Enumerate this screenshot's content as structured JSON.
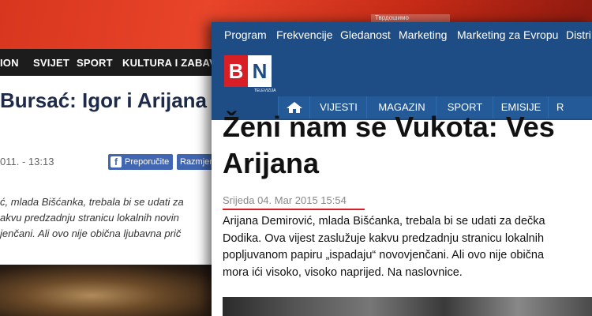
{
  "back_page": {
    "banner_strip_text": "Тврдошимо",
    "nav": [
      "ION",
      "SVIJET",
      "SPORT",
      "KULTURA I ZABAVA"
    ],
    "title": "Bursać: Igor i Arijana",
    "date": "011. - 13:13",
    "recommend_label": "Preporučite",
    "share_label": "Razmjenite",
    "body_lines": [
      "ć, mlada Bišćanka, trebala bi se udati za",
      "akvu predzadnju stranicu lokalnih novin",
      "jenčani. Ali ovo nije obična ljubavna prič"
    ]
  },
  "front_page": {
    "top_nav": [
      "Program",
      "Frekvencije",
      "Gledanost",
      "Marketing",
      "Marketing za Evropu",
      "Distri"
    ],
    "logo": {
      "left": "B",
      "right": "N",
      "sub": "TELEVIZIJA"
    },
    "main_nav": [
      "VIJESTI",
      "MAGAZIN",
      "SPORT",
      "EMISIJE",
      "R"
    ],
    "title_lines": [
      "Ženi nam se Vukota: Ves",
      "Arijana"
    ],
    "date": "Srijeda 04. Mar 2015 15:54",
    "body_lines": [
      "Arijana Demirović, mlada Bišćanka, trebala bi se udati za dečka",
      "Dodika. Ova vijest zaslužuje kakvu predzadnju stranicu lokalnih",
      "popljuvanom papiru „ispadaju“ novovjenčani. Ali ovo nije obična",
      "mora ići visoko, visoko naprijed. Na naslovnice."
    ]
  },
  "colors": {
    "front_header": "#1d4d84",
    "logo_red": "#d91f26",
    "back_nav": "#1c1c1c",
    "facebook_blue": "#4267b2"
  }
}
